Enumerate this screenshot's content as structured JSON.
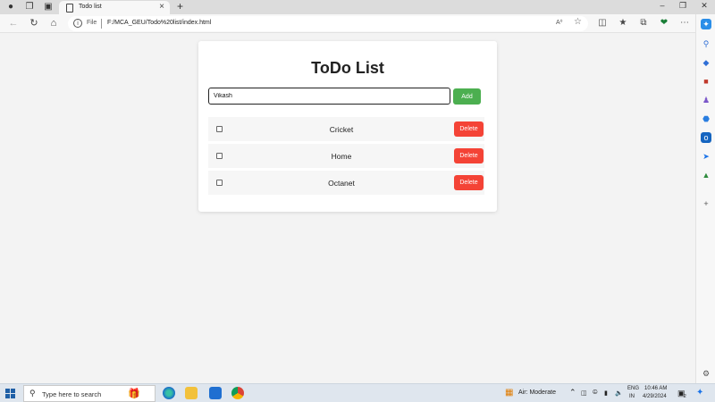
{
  "browser": {
    "tab_title": "Todo list",
    "tab_close": "×",
    "new_tab": "+",
    "address_prefix": "File",
    "url": "F:/MCA_GEU/Todo%20list/index.html",
    "read_aloud": "A⁰",
    "window_controls": {
      "minimize": "–",
      "maximize": "❐",
      "close": "✕"
    }
  },
  "app": {
    "heading": "ToDo List",
    "input_value": "Vikash",
    "add_label": "Add",
    "delete_label": "Delete",
    "items": [
      {
        "text": "Cricket",
        "done": false
      },
      {
        "text": "Home",
        "done": false
      },
      {
        "text": "Octanet",
        "done": false
      }
    ],
    "colors": {
      "add": "#4caf50",
      "delete": "#f44336"
    }
  },
  "taskbar": {
    "search_placeholder": "Type here to search",
    "weather": "Air: Moderate",
    "lang_top": "ENG",
    "lang_bottom": "IN",
    "time": "10:46 AM",
    "date": "4/29/2024",
    "notification_count": "2"
  },
  "sidebar_icons": [
    "copilot-icon",
    "search-icon",
    "tag-icon",
    "briefcase-icon",
    "games-icon",
    "office-icon",
    "outlook-icon",
    "send-icon",
    "tree-icon",
    "add-icon",
    "settings-icon"
  ]
}
